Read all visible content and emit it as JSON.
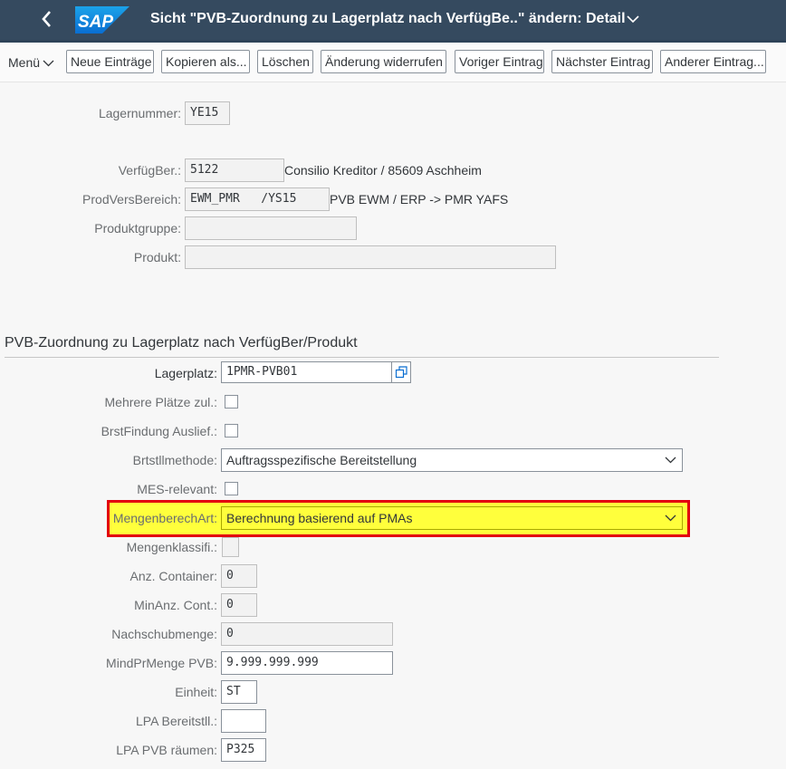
{
  "header": {
    "title": "Sicht \"PVB-Zuordnung zu Lagerplatz nach VerfügBe..\" ändern: Detail"
  },
  "toolbar": {
    "menu_label": "Menü",
    "buttons": [
      "Neue Einträge",
      "Kopieren als...",
      "Löschen",
      "Änderung widerrufen",
      "Voriger Eintrag",
      "Nächster Eintrag",
      "Anderer Eintrag..."
    ]
  },
  "header_fields": {
    "lagernummer": {
      "label": "Lagernummer:",
      "value": "YE15"
    },
    "verfuegber": {
      "label": "VerfügBer.:",
      "value": "5122",
      "desc": "Consilio Kreditor / 85609 Aschheim"
    },
    "prodversbereich": {
      "label": "ProdVersBereich:",
      "value": "EWM_PMR   /YS15",
      "desc": "PVB EWM / ERP -> PMR YAFS"
    },
    "produktgruppe": {
      "label": "Produktgruppe:",
      "value": ""
    },
    "produkt": {
      "label": "Produkt:",
      "value": ""
    }
  },
  "section": {
    "title": "PVB-Zuordnung zu Lagerplatz nach VerfügBer/Produkt",
    "lagerplatz": {
      "label": "Lagerplatz:",
      "value": "1PMR-PVB01"
    },
    "mehrere_plaetze": {
      "label": "Mehrere Plätze zul.:",
      "checked": false
    },
    "brstfindung": {
      "label": "BrstFindung Auslief.:",
      "checked": false
    },
    "brtstllmethode": {
      "label": "Brtstllmethode:",
      "value": "Auftragsspezifische Bereitstellung"
    },
    "mes_relevant": {
      "label": "MES-relevant:",
      "checked": false
    },
    "mengenberechart": {
      "label": "MengenberechArt:",
      "value": "Berechnung basierend auf PMAs"
    },
    "mengenklassifi": {
      "label": "Mengenklassifi.:",
      "value": ""
    },
    "anz_container": {
      "label": "Anz. Container:",
      "value": "0"
    },
    "minanz_cont": {
      "label": "MinAnz. Cont.:",
      "value": "0"
    },
    "nachschubmenge": {
      "label": "Nachschubmenge:",
      "value": "0"
    },
    "mindprmenge": {
      "label": "MindPrMenge PVB:",
      "value": "9.999.999.999"
    },
    "einheit": {
      "label": "Einheit:",
      "value": "ST"
    },
    "lpa_bereitstll": {
      "label": "LPA Bereitstll.:",
      "value": ""
    },
    "lpa_pvb_raeumen": {
      "label": "LPA PVB räumen:",
      "value": "P325"
    }
  },
  "colors": {
    "shell": "#354a5f",
    "highlight_fill": "#ffff3c",
    "highlight_border": "#e3000f",
    "sap_logo_blue": "#0a6ed1"
  },
  "logo_text": "SAP"
}
